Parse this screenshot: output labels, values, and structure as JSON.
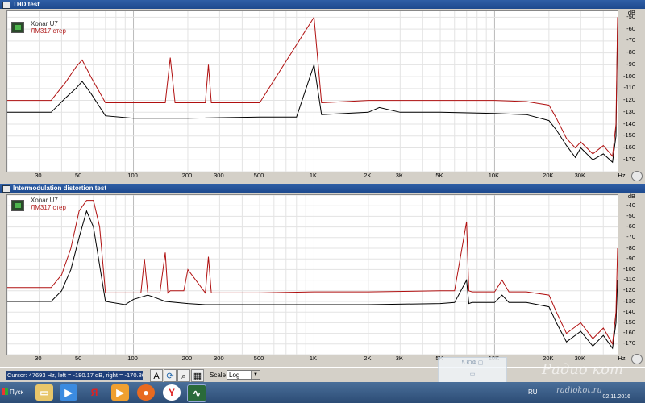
{
  "windows": [
    {
      "title": "THD test",
      "legend": [
        "Xonar U7",
        "ЛМ317 стер"
      ],
      "y_unit": "dB",
      "y_ticks": [
        "-50",
        "-60",
        "-70",
        "-80",
        "-90",
        "-100",
        "-110",
        "-120",
        "-130",
        "-140",
        "-150",
        "-160",
        "-170"
      ],
      "x_ticks": [
        "30",
        "50",
        "100",
        "200",
        "300",
        "500",
        "1K",
        "2K",
        "3K",
        "5K",
        "10K",
        "20K",
        "30K",
        "Hz"
      ]
    },
    {
      "title": "Intermodulation distortion test",
      "legend": [
        "Xonar U7",
        "ЛМ317 стер"
      ],
      "y_unit": "dB",
      "y_ticks": [
        "-40",
        "-50",
        "-60",
        "-70",
        "-80",
        "-90",
        "-100",
        "-110",
        "-120",
        "-130",
        "-140",
        "-150",
        "-160",
        "-170"
      ],
      "x_ticks": [
        "30",
        "50",
        "100",
        "200",
        "300",
        "500",
        "1K",
        "2K",
        "3K",
        "5K",
        "10K",
        "20K",
        "30K",
        "Hz"
      ]
    }
  ],
  "statusbar": {
    "cursor_text": "Cursor: 47693 Hz, left = -180.17 dB, right = -170.86 dB",
    "scale_label": "Scale",
    "scale_value": "Log"
  },
  "taskbar": {
    "start_label": "Пуск",
    "lang": "RU",
    "date": "02.11.2016"
  },
  "watermark": {
    "brand": "Радио кот",
    "site": "radiokot.ru"
  },
  "colors": {
    "series_black": "#000000",
    "series_red": "#b01010",
    "plot_bg": "#ffffff",
    "title_bar": "#2a5a9e"
  },
  "chart_data": [
    {
      "type": "line",
      "title": "THD test",
      "ylabel": "dB",
      "xlabel": "Hz",
      "xscale": "log",
      "xlim": [
        20,
        48000
      ],
      "ylim": [
        -180,
        -45
      ],
      "grid": true,
      "legend": "top-left",
      "series": [
        {
          "name": "Xonar U7",
          "color": "#000000",
          "x": [
            20,
            35,
            42,
            48,
            52,
            58,
            70,
            100,
            200,
            500,
            800,
            1000,
            1100,
            2000,
            2300,
            3000,
            5000,
            10000,
            15000,
            20000,
            22000,
            25000,
            28000,
            30000,
            35000,
            40000,
            45000,
            47000,
            48000
          ],
          "y": [
            -130,
            -130,
            -118,
            -110,
            -104,
            -114,
            -133,
            -135,
            -135,
            -134,
            -134,
            -90,
            -132,
            -130,
            -126,
            -130,
            -130,
            -131,
            -132,
            -137,
            -145,
            -158,
            -168,
            -160,
            -170,
            -165,
            -172,
            -150,
            -55
          ]
        },
        {
          "name": "ЛМ317 стер",
          "color": "#b01010",
          "x": [
            20,
            35,
            42,
            48,
            52,
            58,
            70,
            100,
            150,
            160,
            170,
            200,
            250,
            260,
            270,
            300,
            500,
            1000,
            1100,
            2000,
            3000,
            5000,
            10000,
            15000,
            20000,
            22000,
            25000,
            28000,
            30000,
            35000,
            40000,
            45000,
            47000,
            48000
          ],
          "y": [
            -120,
            -120,
            -105,
            -92,
            -86,
            -100,
            -122,
            -122,
            -122,
            -84,
            -122,
            -122,
            -122,
            -90,
            -122,
            -122,
            -122,
            -50,
            -122,
            -120,
            -120,
            -120,
            -120,
            -121,
            -124,
            -135,
            -152,
            -160,
            -155,
            -165,
            -158,
            -167,
            -140,
            -50
          ]
        }
      ]
    },
    {
      "type": "line",
      "title": "Intermodulation distortion test",
      "ylabel": "dB",
      "xlabel": "Hz",
      "xscale": "log",
      "xlim": [
        20,
        48000
      ],
      "ylim": [
        -180,
        -30
      ],
      "grid": true,
      "legend": "top-left",
      "series": [
        {
          "name": "Xonar U7",
          "color": "#000000",
          "x": [
            20,
            35,
            40,
            45,
            50,
            55,
            60,
            70,
            90,
            100,
            120,
            130,
            150,
            200,
            250,
            500,
            1000,
            2000,
            5000,
            6000,
            7000,
            7200,
            7500,
            8000,
            10000,
            11000,
            12000,
            15000,
            20000,
            22000,
            25000,
            30000,
            35000,
            40000,
            45000,
            47000,
            48000
          ],
          "y": [
            -130,
            -130,
            -120,
            -100,
            -70,
            -45,
            -60,
            -130,
            -133,
            -128,
            -124,
            -126,
            -130,
            -132,
            -133,
            -133,
            -133,
            -133,
            -132,
            -131,
            -110,
            -132,
            -131,
            -131,
            -131,
            -124,
            -131,
            -131,
            -135,
            -150,
            -168,
            -158,
            -172,
            -162,
            -174,
            -150,
            -110
          ]
        },
        {
          "name": "ЛМ317 стер",
          "color": "#b01010",
          "x": [
            20,
            35,
            40,
            45,
            50,
            55,
            60,
            65,
            70,
            90,
            110,
            115,
            120,
            140,
            150,
            155,
            160,
            190,
            200,
            250,
            260,
            270,
            500,
            1000,
            2000,
            5000,
            6000,
            7000,
            7200,
            7500,
            10000,
            11000,
            12000,
            15000,
            20000,
            22000,
            25000,
            30000,
            35000,
            40000,
            45000,
            47000,
            48000
          ],
          "y": [
            -117,
            -117,
            -105,
            -80,
            -45,
            -35,
            -35,
            -60,
            -122,
            -122,
            -122,
            -90,
            -122,
            -122,
            -84,
            -122,
            -120,
            -120,
            -100,
            -122,
            -88,
            -122,
            -122,
            -121,
            -121,
            -120,
            -120,
            -55,
            -120,
            -121,
            -121,
            -110,
            -121,
            -121,
            -124,
            -140,
            -160,
            -150,
            -165,
            -155,
            -170,
            -140,
            -80
          ]
        }
      ]
    }
  ]
}
